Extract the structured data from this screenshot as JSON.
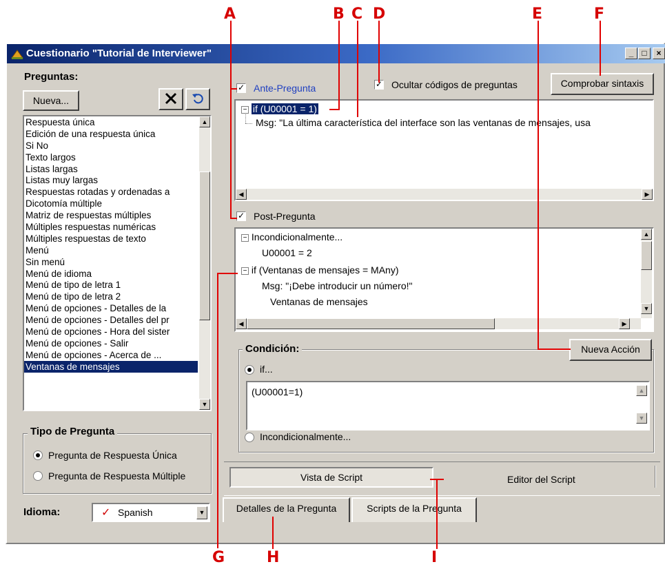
{
  "window": {
    "title": "Cuestionario \"Tutorial de Interviewer\""
  },
  "callouts": [
    "A",
    "B",
    "C",
    "D",
    "E",
    "F",
    "G",
    "H",
    "I"
  ],
  "left_panel": {
    "heading": "Preguntas:",
    "new_button": "Nueva...",
    "delete_icon": "x-icon",
    "undo_icon": "undo-icon",
    "questions": [
      "Respuesta única",
      "Edición de una respuesta única",
      "Si No",
      "Texto largos",
      "Listas largas",
      "Listas muy largas",
      "Respuestas rotadas y ordenadas a",
      "Dicotomía múltiple",
      "Matriz de respuestas múltiples",
      "Múltiples respuestas numéricas",
      "Múltiples respuestas de texto",
      "Menú",
      "Sin menú",
      "Menú de idioma",
      "Menú de tipo de letra 1",
      "Menú de tipo de letra 2",
      "Menú de opciones - Detalles de la",
      "Menú de opciones - Detalles del pr",
      "Menú de opciones - Hora del sister",
      "Menú de opciones - Salir",
      "Menú de opciones - Acerca de ...",
      "Ventanas de mensajes"
    ],
    "selected_index": 21,
    "type_group": {
      "label": "Tipo de Pregunta",
      "options": [
        "Pregunta de Respuesta Única",
        "Pregunta de Respuesta Múltiple"
      ],
      "selected": 0
    },
    "language_label": "Idioma:",
    "language_value": "Spanish"
  },
  "right_panel": {
    "ante_label": "Ante-Pregunta",
    "hide_codes_label": "Ocultar códigos de preguntas",
    "check_syntax_button": "Comprobar sintaxis",
    "ante_tree": {
      "node": "if (U00001 = 1)",
      "child": "Msg: \"La última característica del interface son las ventanas de mensajes, usa"
    },
    "post_label": "Post-Pregunta",
    "post_tree": {
      "node1": "Incondicionalmente...",
      "node1_child": "U00001 = 2",
      "node2": "if (Ventanas de mensajes = MAny)",
      "node2_child1": "Msg: \"¡Debe introducir un número!\"",
      "node2_child2": "Ventanas de mensajes"
    },
    "new_action_button": "Nueva Acción",
    "condition": {
      "label": "Condición:",
      "if_option": "if...",
      "expression": "(U00001=1)",
      "unconditional_option": "Incondicionalmente..."
    },
    "view_tabs": [
      "Vista de Script",
      "Editor del Script"
    ]
  },
  "bottom_tabs": [
    "Detalles de la Pregunta",
    "Scripts de la Pregunta"
  ]
}
